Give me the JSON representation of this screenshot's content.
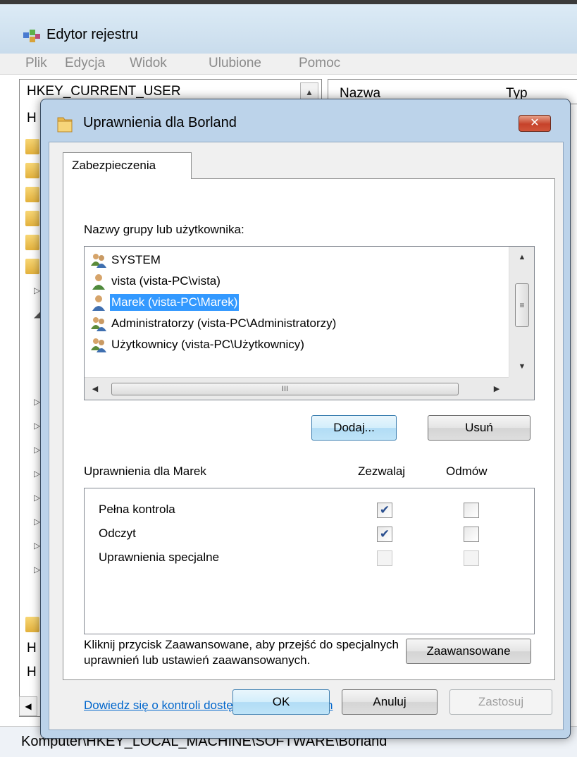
{
  "regedit": {
    "title": "Edytor rejestru",
    "menu": [
      "Plik",
      "Edycja",
      "Widok",
      "Ulubione",
      "Pomoc"
    ],
    "tree_top_label": "HKEY_CURRENT_USER",
    "tree_letters": [
      "H",
      "H",
      "H"
    ],
    "list_columns": [
      "Nazwa",
      "Typ"
    ],
    "status_text": "Komputer\\HKEY_LOCAL_MACHINE\\SOFTWARE\\Borland"
  },
  "dialog": {
    "title": "Uprawnienia dla Borland",
    "close_label": "✕",
    "tab_label": "Zabezpieczenia",
    "users_label": "Nazwy grupy lub użytkownika:",
    "users": [
      {
        "label": "SYSTEM",
        "icon": "group-icon",
        "selected": false
      },
      {
        "label": "vista (vista-PC\\vista)",
        "icon": "user-icon",
        "selected": false
      },
      {
        "label": "Marek (vista-PC\\Marek)",
        "icon": "user-icon",
        "selected": true
      },
      {
        "label": "Administratorzy (vista-PC\\Administratorzy)",
        "icon": "group-icon",
        "selected": false
      },
      {
        "label": "Użytkownicy (vista-PC\\Użytkownicy)",
        "icon": "group-icon",
        "selected": false
      }
    ],
    "hscroll_grip": "III",
    "add_button": "Dodaj...",
    "remove_button": "Usuń",
    "permissions_label": "Uprawnienia dla Marek",
    "allow_header": "Zezwalaj",
    "deny_header": "Odmów",
    "permissions": [
      {
        "name": "Pełna kontrola",
        "allow": true,
        "deny": false,
        "enabled": true
      },
      {
        "name": "Odczyt",
        "allow": true,
        "deny": false,
        "enabled": true
      },
      {
        "name": "Uprawnienia specjalne",
        "allow": false,
        "deny": false,
        "enabled": false
      }
    ],
    "advanced_text": "Kliknij przycisk Zaawansowane, aby przejść do specjalnych uprawnień lub ustawień zaawansowanych.",
    "advanced_button": "Zaawansowane",
    "help_link": "Dowiedz się o kontroli dostępu i uprawnieniach",
    "ok_button": "OK",
    "cancel_button": "Anuluj",
    "apply_button": "Zastosuj",
    "colors": {
      "selection": "#3399ff",
      "link": "#0066cc",
      "close_button": "#c6422a",
      "frame": "#bcd3ea"
    }
  }
}
